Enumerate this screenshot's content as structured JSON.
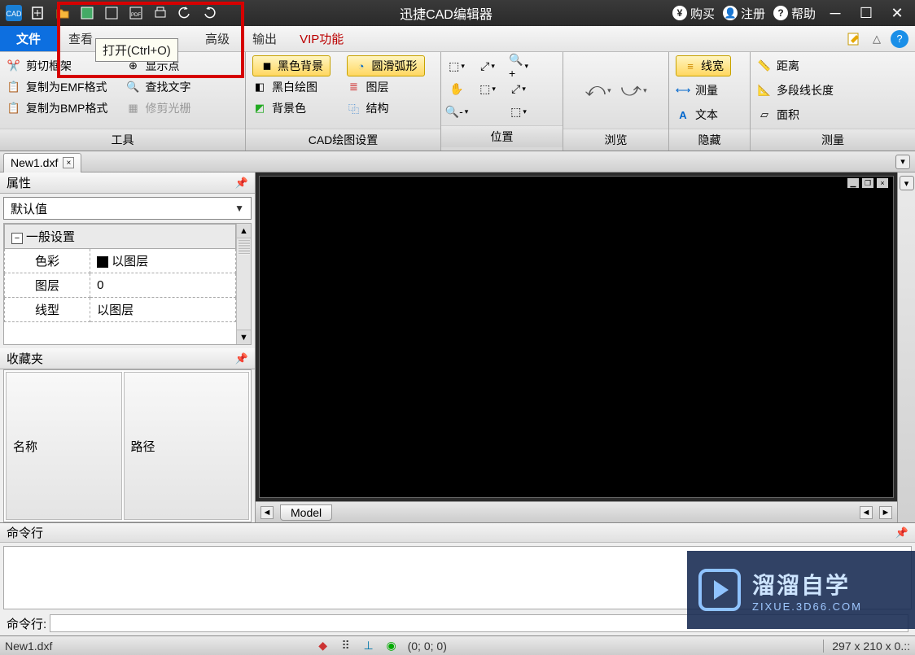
{
  "title": "迅捷CAD编辑器",
  "titlebar_right": {
    "buy": "购买",
    "register": "注册",
    "help": "帮助"
  },
  "tooltip": "打开(Ctrl+O)",
  "menu": {
    "file": "文件",
    "view": "查看",
    "advanced": "高级",
    "output": "输出",
    "vip": "VIP功能"
  },
  "ribbon": {
    "tools": {
      "label": "工具",
      "clip_frame": "剪切框架",
      "copy_emf": "复制为EMF格式",
      "copy_bmp": "复制为BMP格式",
      "show_points": "显示点",
      "find_text": "查找文字",
      "trim_raster": "修剪光栅"
    },
    "cad": {
      "label": "CAD绘图设置",
      "black_bg": "黑色背景",
      "bw_draw": "黑白绘图",
      "bg_color": "背景色",
      "smooth_arc": "圆滑弧形",
      "layers": "图层",
      "structure": "结构"
    },
    "pos": {
      "label": "位置"
    },
    "browse": {
      "label": "浏览"
    },
    "hide": {
      "label": "隐藏",
      "lineweight": "线宽",
      "measure": "测量",
      "text": "文本"
    },
    "meas": {
      "label": "测量",
      "distance": "距离",
      "polylength": "多段线长度",
      "area": "面积"
    }
  },
  "doc_tab": "New1.dxf",
  "panels": {
    "props_title": "属性",
    "default_value": "默认值",
    "general": "一般设置",
    "rows": {
      "color_label": "色彩",
      "color_value": "以图层",
      "layer_label": "图层",
      "layer_value": "0",
      "ltype_label": "线型",
      "ltype_value": "以图层"
    },
    "fav_title": "收藏夹",
    "fav_name": "名称",
    "fav_path": "路径"
  },
  "model_tab": "Model",
  "cmd": {
    "title": "命令行",
    "prompt": "命令行:"
  },
  "status": {
    "file": "New1.dxf",
    "coords": "(0; 0; 0)",
    "paper": "297 x 210 x 0.::"
  },
  "watermark": {
    "brand": "溜溜自学",
    "url": "ZIXUE.3D66.COM"
  }
}
